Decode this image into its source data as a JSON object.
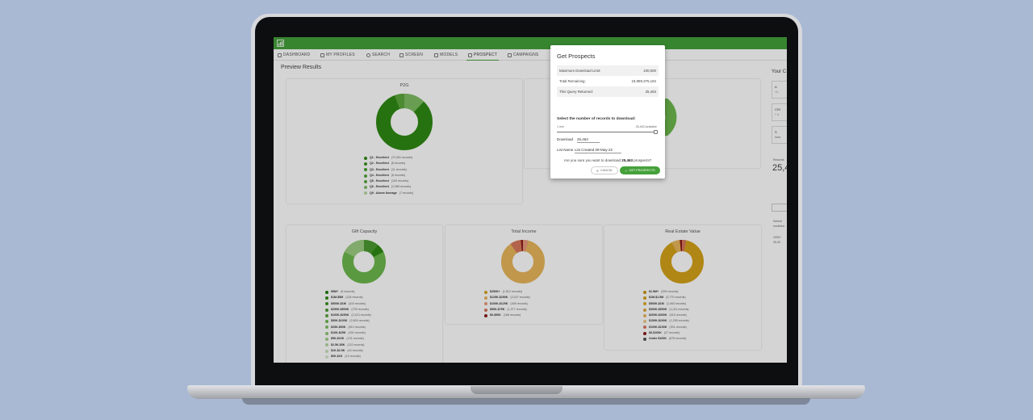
{
  "nav": {
    "items": [
      {
        "label": "DASHBOARD"
      },
      {
        "label": "MY PROFILES"
      },
      {
        "label": "SEARCH"
      },
      {
        "label": "SCREEN"
      },
      {
        "label": "MODELS"
      },
      {
        "label": "PROSPECT"
      },
      {
        "label": "CAMPAIGNS"
      }
    ],
    "active_index": 5
  },
  "page": {
    "title": "Preview Results"
  },
  "colors": {
    "brand": "#44a13a",
    "dark_green": "#2e8a14",
    "light_green": "#6db84d",
    "gold": "#d4a21a",
    "tan": "#e8b65c",
    "red": "#c0392b"
  },
  "charts": {
    "p2g": {
      "title": "P2G",
      "legend": [
        {
          "label": "Q1 - Excellent",
          "count": "(72,451 records)"
        },
        {
          "label": "Q2 - Excellent",
          "count": "(8 records)"
        },
        {
          "label": "Q3 - Excellent",
          "count": "(11 records)"
        },
        {
          "label": "Q4 - Excellent",
          "count": "(6 records)"
        },
        {
          "label": "Q5 - Excellent",
          "count": "(109 records)"
        },
        {
          "label": "Q6 - Excellent",
          "count": "(1,985 records)"
        },
        {
          "label": "Q9 - Above Average",
          "count": "(7 records)"
        }
      ]
    },
    "gift": {
      "title": "Gift Capacity",
      "legend": [
        {
          "label": "$5M+",
          "count": "(5 records)"
        },
        {
          "label": "$1M-$5M",
          "count": "(128 records)"
        },
        {
          "label": "$500K-$1M",
          "count": "(410 records)"
        },
        {
          "label": "$250K-$500K",
          "count": "(709 records)"
        },
        {
          "label": "$100K-$250K",
          "count": "(2,413 records)"
        },
        {
          "label": "$50K-$100K",
          "count": "(2,600 records)"
        },
        {
          "label": "$25K-$50K",
          "count": "(812 records)"
        },
        {
          "label": "$10K-$25K",
          "count": "(491 records)"
        },
        {
          "label": "$5K-$10K",
          "count": "(131 records)"
        },
        {
          "label": "$2.5K-$5K",
          "count": "(112 records)"
        },
        {
          "label": "$1K-$2.5K",
          "count": "(44 records)"
        },
        {
          "label": "$0K-$1K",
          "count": "(12 records)"
        }
      ]
    },
    "income": {
      "title": "Total Income",
      "legend": [
        {
          "label": "$250K+",
          "count": "(1,512 records)"
        },
        {
          "label": "$125K-$250K",
          "count": "(2,027 records)"
        },
        {
          "label": "$100K-$125K",
          "count": "(406 records)"
        },
        {
          "label": "$50K-$75K",
          "count": "(1,377 records)"
        },
        {
          "label": "$0-$50K",
          "count": "(168 records)"
        }
      ]
    },
    "real_estate": {
      "title": "Real Estate Value",
      "legend": [
        {
          "label": "$1.5M+",
          "count": "(209 records)"
        },
        {
          "label": "$1M-$1.5M",
          "count": "(3,770 records)"
        },
        {
          "label": "$500K-$1M",
          "count": "(1,063 records)"
        },
        {
          "label": "$300K-$500K",
          "count": "(1,011 records)"
        },
        {
          "label": "$200K-$300K",
          "count": "(615 records)"
        },
        {
          "label": "$150K-$200K",
          "count": "(1,295 records)"
        },
        {
          "label": "$100K-$150K",
          "count": "(301 records)"
        },
        {
          "label": "$0-$100K",
          "count": "(27 records)"
        },
        {
          "label": "Under $100K",
          "count": "(678 records)"
        }
      ]
    }
  },
  "right_panel": {
    "title": "Your C",
    "big_number": "25,4",
    "records_label": "Records",
    "selection_label": "Selecti",
    "box1_title": "A",
    "box1_sub": "+1,",
    "box2_title": "CRI",
    "box2_sub": "+ 4",
    "box3_title": "S",
    "box3_sub": "Note",
    "text1": "modeled",
    "text2": "1000+",
    "text3": "25,40"
  },
  "modal": {
    "title": "Get Prospects",
    "rows": [
      {
        "label": "Maximum Download Limit:",
        "value": "100,000"
      },
      {
        "label": "Total Remaining:",
        "value": "19,999,375,184"
      },
      {
        "label": "This Query Returned:",
        "value": "25,463"
      }
    ],
    "select_label": "Select the number of records to download:",
    "slider_min": "1 min",
    "slider_max": "25,463 Available",
    "download_label": "Download",
    "download_value": "25,463",
    "list_name_label": "List Name",
    "list_name_value": "List Created 09-May-22",
    "confirm_prefix": "Are you sure you want to download",
    "confirm_count": "25,463",
    "confirm_suffix": "prospects?",
    "cancel_label": "CANCEL",
    "get_label": "GET PROSPECTS"
  }
}
